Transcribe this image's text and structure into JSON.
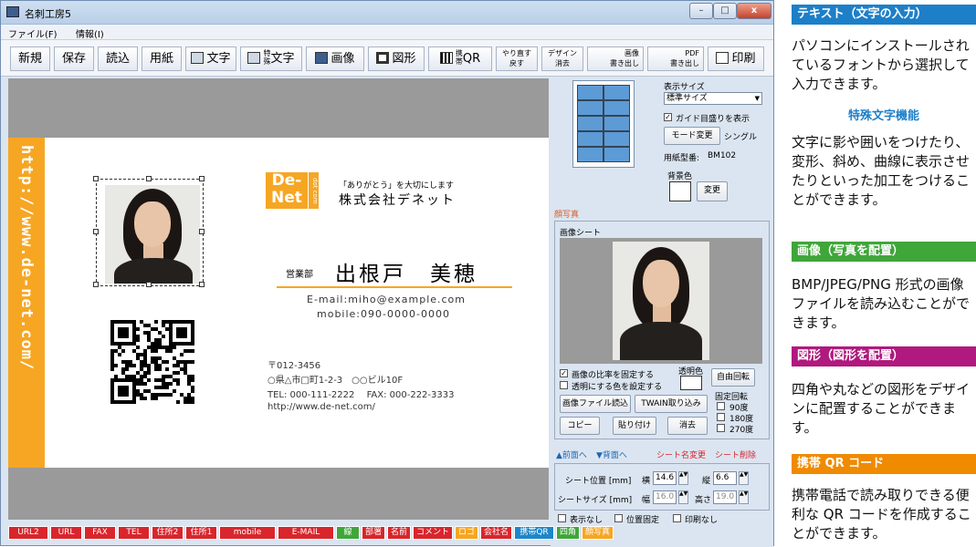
{
  "window": {
    "title": "名刺工房5",
    "min": "–",
    "max": "□",
    "close": "x"
  },
  "menu": {
    "file": "ファイル(F)",
    "info": "情報(I)"
  },
  "toolbar": {
    "new": "新規",
    "save": "保存",
    "load": "読込",
    "paper": "用紙",
    "text": "文字",
    "special_text_a": "特",
    "special_text_b": "殊",
    "special_text": "文字",
    "image": "画像",
    "shape": "図形",
    "qr_a": "携",
    "qr_b": "帯",
    "qr": "QR",
    "redo": "やり直す",
    "undo": "戻す",
    "design_clear_a": "デザイン",
    "design_clear_b": "消去",
    "image_export_a": "画像",
    "image_export_b": "書き出し",
    "pdf_export_a": "PDF",
    "pdf_export_b": "書き出し",
    "print": "印刷"
  },
  "card": {
    "url_vertical": "http://www.de-net.com/",
    "logo_main_1": "De-",
    "logo_main_2": "Net",
    "logo_side": "dot com",
    "tagline": "「ありがとう」を大切にします",
    "company": "株式会社デネット",
    "department": "営業部",
    "name": "出根戸　美穂",
    "email": "E-mail:miho@example.com",
    "mobile": "mobile:090-0000-0000",
    "postal": "〒012-3456",
    "address": "○県△市□町1-2-3　○○ビル10F",
    "tel_fax": "TEL: 000-111-2222　 FAX: 000-222-3333",
    "web": "http://www.de-net.com/"
  },
  "side_panel": {
    "display_size_label": "表示サイズ",
    "display_size_value": "標準サイズ",
    "guide_checkbox": "ガイド目盛りを表示",
    "mode_change": "モード変更",
    "mode_value": "シングル",
    "paper_model_label": "用紙型番:",
    "paper_model_value": "BM102",
    "bg_color_label": "背景色",
    "change_button": "変更"
  },
  "sheet": {
    "group_label": "顔写真",
    "sheet_label": "画像シート",
    "fix_ratio": "画像の比率を固定する",
    "set_transparent": "透明にする色を設定する",
    "transparent_label": "透明色",
    "free_rotate": "自由回転",
    "fixed_rotate_label": "固定回転",
    "rot90": "90度",
    "rot180": "180度",
    "rot270": "270度",
    "load_image": "画像ファイル読込",
    "twain": "TWAIN取り込み",
    "copy": "コピー",
    "paste": "貼り付け",
    "delete": "消去"
  },
  "order": {
    "front": "▲前面へ",
    "back": "▼背面へ",
    "rename": "シート名変更",
    "remove": "シート削除"
  },
  "position": {
    "pos_label": "シート位置 [mm]",
    "x_label": "横",
    "x_value": "14.6",
    "y_label": "縦",
    "y_value": "6.6",
    "size_label": "シートサイズ [mm]",
    "w_label": "幅",
    "w_value": "16.0",
    "h_label": "高さ",
    "h_value": "19.0",
    "hide": "表示なし",
    "lock": "位置固定",
    "noprint": "印刷なし"
  },
  "sheet_tabs": [
    {
      "label": "URL2",
      "color": "#d8262c"
    },
    {
      "label": "URL",
      "color": "#d8262c"
    },
    {
      "label": "FAX",
      "color": "#d8262c"
    },
    {
      "label": "TEL",
      "color": "#d8262c"
    },
    {
      "label": "住所2",
      "color": "#d8262c"
    },
    {
      "label": "住所1",
      "color": "#d8262c"
    },
    {
      "label": "mobile",
      "color": "#d8262c"
    },
    {
      "label": "E-MAIL",
      "color": "#d8262c"
    },
    {
      "label": "線",
      "color": "#3fa63a"
    },
    {
      "label": "部署",
      "color": "#d8262c"
    },
    {
      "label": "名前",
      "color": "#d8262c"
    },
    {
      "label": "コメント",
      "color": "#d8262c"
    },
    {
      "label": "ロゴ",
      "color": "#f6a623"
    },
    {
      "label": "会社名",
      "color": "#d8262c"
    },
    {
      "label": "携帯QR",
      "color": "#1e86c8"
    },
    {
      "label": "四角",
      "color": "#3fa63a"
    },
    {
      "label": "顔写真",
      "color": "#f6a623"
    }
  ],
  "promo": {
    "text_title": "テキスト（文字の入力）",
    "text_body": "パソコンにインストールされているフォントから選択して入力できます。",
    "special_title": "特殊文字機能",
    "special_body": "文字に影や囲いをつけたり、変形、斜め、曲線に表示させたりといった加工をつけることができます。",
    "image_title": "画像（写真を配置）",
    "image_body": "BMP/JPEG/PNG 形式の画像ファイルを読み込むことができます。",
    "shape_title": "図形（図形を配置）",
    "shape_body": "四角や丸などの図形をデザインに配置することができます。",
    "qr_title": "携帯 QR コード",
    "qr_body": "携帯電話で読み取りできる便利な QR コードを作成することができます。"
  },
  "colors": {
    "accent_orange": "#f6a623",
    "text_blue": "#1d7fc8",
    "text_green": "#3fa63a",
    "shape_magenta": "#b0197e"
  }
}
